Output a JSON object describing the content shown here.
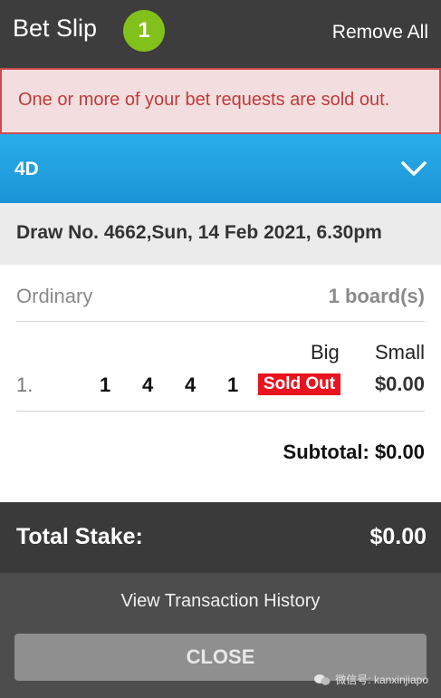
{
  "header": {
    "title": "Bet Slip",
    "badge_count": "1",
    "remove_all": "Remove All"
  },
  "alert": {
    "message": "One or more of your bet requests are sold out."
  },
  "game": {
    "name": "4D",
    "expand_icon": "chevron-down-icon"
  },
  "draw": {
    "info": "Draw No. 4662,Sun, 14 Feb 2021, 6.30pm"
  },
  "bet": {
    "type": "Ordinary",
    "boards": "1 board(s)",
    "columns": {
      "big": "Big",
      "small": "Small"
    },
    "line": {
      "index": "1.",
      "digits": [
        "1",
        "4",
        "4",
        "1"
      ],
      "big_status": "Sold Out",
      "small_amount": "$0.00"
    },
    "subtotal": "Subtotal: $0.00"
  },
  "total": {
    "label": "Total Stake:",
    "value": "$0.00"
  },
  "footer": {
    "view_history": "View Transaction History",
    "close_label": "CLOSE",
    "watermark": "微信号: kanxinjiapo"
  },
  "colors": {
    "badge": "#82c01c",
    "alert_bg": "#f2dede",
    "alert_text": "#c0393b",
    "game_bar": "#1a93d6",
    "sold_out": "#e8141f"
  }
}
